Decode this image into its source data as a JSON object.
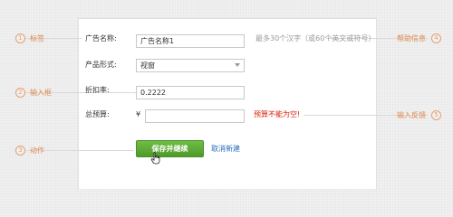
{
  "annotations": {
    "left": [
      {
        "number": "1",
        "label": "标签"
      },
      {
        "number": "2",
        "label": "输入框"
      },
      {
        "number": "3",
        "label": "动作"
      }
    ],
    "right": [
      {
        "number": "4",
        "label": "帮助信息"
      },
      {
        "number": "5",
        "label": "输入反馈"
      }
    ]
  },
  "form": {
    "ad_name": {
      "label": "广告名称:",
      "value": "广告名称1",
      "hint": "最多30个汉字（或60个英文或符号）"
    },
    "product_form": {
      "label": "产品形式:",
      "selected": "视窗"
    },
    "discount_rate": {
      "label": "折扣率:",
      "value": "0.2222"
    },
    "total_budget": {
      "label": "总预算:",
      "currency_symbol": "¥",
      "value": "",
      "error": "预算不能为空!"
    }
  },
  "actions": {
    "save_continue_label": "保存并继续",
    "cancel_new_label": "取消新建"
  },
  "colors": {
    "annotation": "#e08a4c",
    "button_green": "#5aa833",
    "error": "#d81e06",
    "link": "#2a6ebd"
  }
}
